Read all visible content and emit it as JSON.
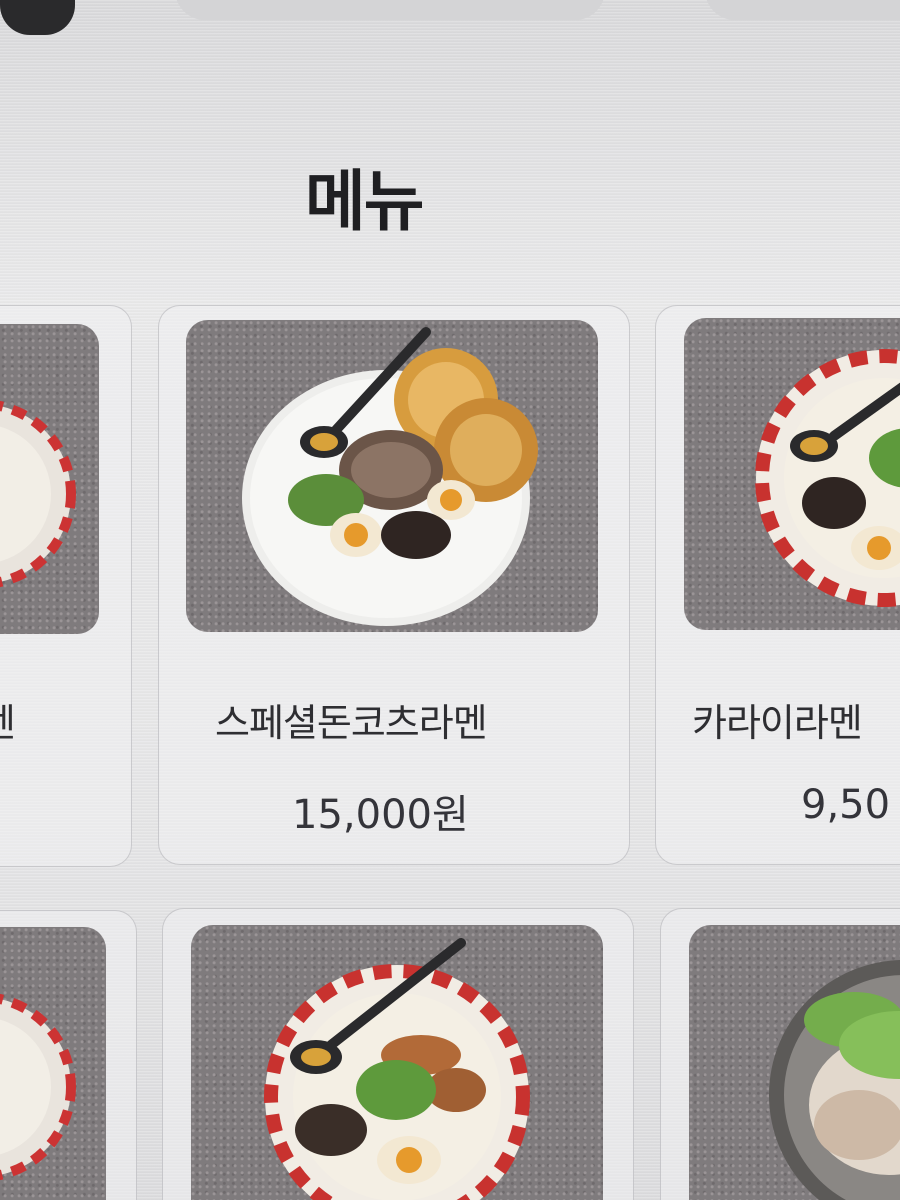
{
  "page": {
    "title": "메뉴"
  },
  "menu": {
    "items": [
      {
        "name": "스페셜돈코츠라멘",
        "price": "15,000원"
      },
      {
        "name": "카라이라멘",
        "price": "9,50"
      },
      {
        "name": "멘",
        "price": ""
      }
    ]
  },
  "colors": {
    "background": "#e4e4e6",
    "photo_bg": "#7f7b7d",
    "text": "#2b2b2e"
  }
}
